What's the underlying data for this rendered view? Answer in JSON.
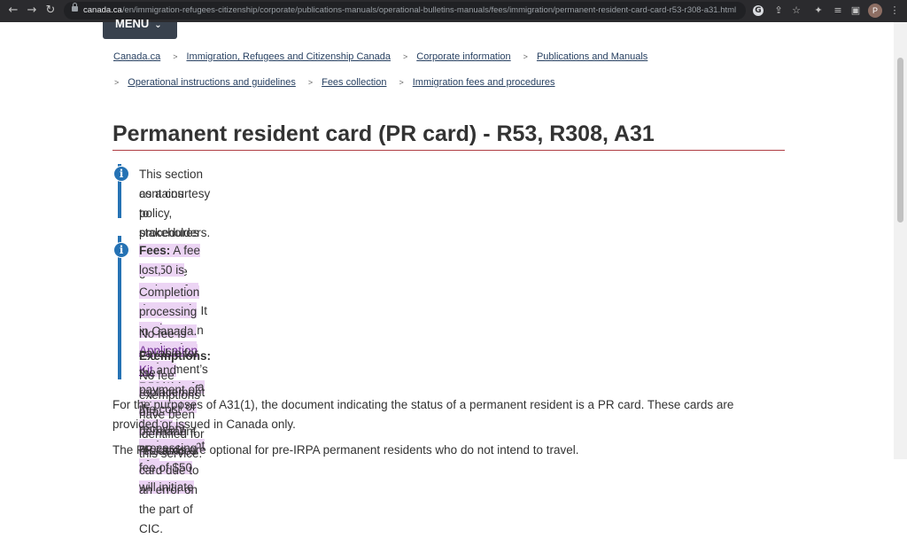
{
  "browser": {
    "url_host": "canada.ca",
    "url_path": "/en/immigration-refugees-citizenship/corporate/publications-manuals/operational-bulletins-manuals/fees/immigration/permanent-resident-card-card-r53-r308-a31.html",
    "avatar_letter": "P"
  },
  "header": {
    "menu_label": "MENU"
  },
  "breadcrumb": {
    "row1": [
      "Canada.ca",
      "Immigration, Refugees and Citizenship Canada",
      "Corporate information",
      "Publications and Manuals"
    ],
    "row2": [
      "Operational instructions and guidelines",
      "Fees collection",
      "Immigration fees and procedures"
    ]
  },
  "page": {
    "title": "Permanent resident card (PR card) - R53, R308, A31"
  },
  "notice": {
    "line1": "This section contains policy, procedures and guidance used by IRCC staff. It is posted on the department’s website",
    "line2": "as a courtesy to stakeholders."
  },
  "fees": {
    "label": "Fees:",
    "text1": " A fee of $50 is payable for processing an application for the renewal of a PR card or for the replacement of a",
    "text1b": "lost, stolen or destroyed card made under R53(1)(b).",
    "completion_pre": "Completion of the ",
    "kit_link": "PR Card Application Kit",
    "completion_post": " and payment of the cost recovery processing fee of $50 will initiate",
    "completion_2": "processing in Canada.",
    "no_fee": "No fee is payable for the replacement of a permanent residence card due to an error on the part of CIC.",
    "exemptions_label": "Exemptions:",
    "exemptions_text": " No fee exemptions have been identified for this service."
  },
  "body": {
    "para1_line1": "For the purposes of A31(1), the document indicating the status of a permanent resident is a PR card. These cards are",
    "para1_line2": "provided or issued in Canada only.",
    "para2": "The PR cards are optional for pre-IRPA permanent residents who do not intend to travel."
  }
}
